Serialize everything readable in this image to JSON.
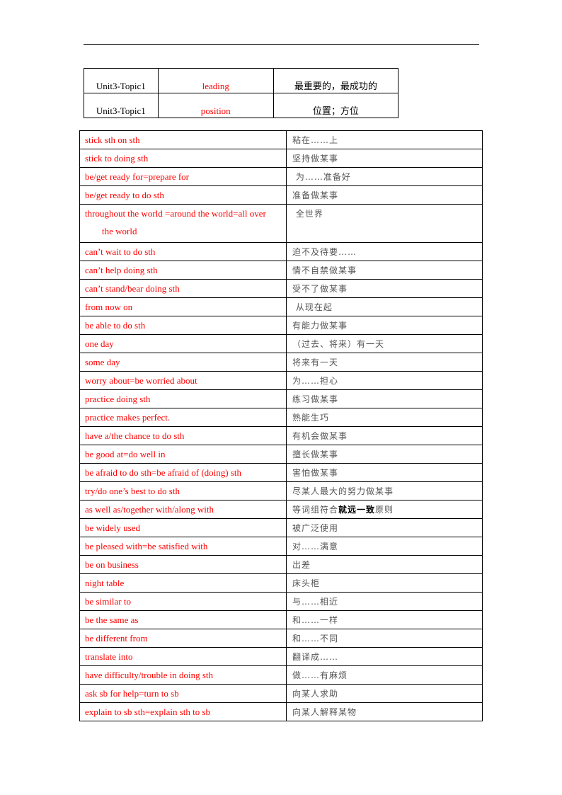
{
  "header_rule": true,
  "top_table": {
    "rows": [
      {
        "unit": "Unit3-Topic1",
        "word": "leading",
        "meaning": "最重要的，最成功的"
      },
      {
        "unit": "Unit3-Topic1",
        "word": "position",
        "meaning": "位置；方位"
      }
    ]
  },
  "phrase_table": {
    "rows": [
      {
        "en": "stick sth on sth",
        "zh": "粘在……上"
      },
      {
        "en": "stick to doing sth",
        "zh": "坚持做某事"
      },
      {
        "en": "be/get ready for=prepare for",
        "zh": " 为……准备好"
      },
      {
        "en": "be/get ready to do sth",
        "zh": "准备做某事"
      },
      {
        "en": "throughout the world =around the world=all over",
        "en_cont": "the world",
        "zh": " 全世界"
      },
      {
        "en": "can’t wait to do sth",
        "zh": "迫不及待要……"
      },
      {
        "en": "can’t help doing sth",
        "zh": "情不自禁做某事"
      },
      {
        "en": "can’t stand/bear doing sth",
        "zh": "受不了做某事"
      },
      {
        "en": "from now on",
        "zh": " 从现在起"
      },
      {
        "en": "be able to do sth",
        "zh": "有能力做某事"
      },
      {
        "en": "one day",
        "zh": "（过去、将来）有一天"
      },
      {
        "en": "some day",
        "zh": "将来有一天"
      },
      {
        "en": "worry about=be worried about",
        "zh": "为……担心"
      },
      {
        "en": "practice doing sth",
        "zh": "练习做某事"
      },
      {
        "en": "practice makes perfect.",
        "zh": "熟能生巧"
      },
      {
        "en": "have a/the chance to do sth",
        "zh": "有机会做某事"
      },
      {
        "en": "be good at=do well in",
        "zh": "擅长做某事"
      },
      {
        "en": "be afraid to do sth=be afraid of (doing) sth",
        "zh": "害怕做某事"
      },
      {
        "en": "try/do one’s best to do sth",
        "zh": "尽某人最大的努力做某事"
      },
      {
        "en": "as well as/together with/along with",
        "zh_pre": "等词组符合",
        "zh_bold": "就远一致",
        "zh_post": "原则"
      },
      {
        "en": "be widely used",
        "zh": "被广泛使用"
      },
      {
        "en": "be pleased with=be satisfied with",
        "zh": "对……满意"
      },
      {
        "en": "be on business",
        "zh": "出差"
      },
      {
        "en": "night table",
        "zh": "床头柜"
      },
      {
        "en": "be similar to",
        "zh": "与……相近"
      },
      {
        "en": "be the same as",
        "zh": "和……一样"
      },
      {
        "en": "be different from",
        "zh": "和……不同"
      },
      {
        "en": "translate into",
        "zh": "翻译成……"
      },
      {
        "en": "have difficulty/trouble in doing sth",
        "zh": "做……有麻烦"
      },
      {
        "en": "ask sb for help=turn to sb",
        "zh": "向某人求助"
      },
      {
        "en": "explain to sb sth=explain sth to sb",
        "zh": "向某人解释某物"
      }
    ]
  }
}
